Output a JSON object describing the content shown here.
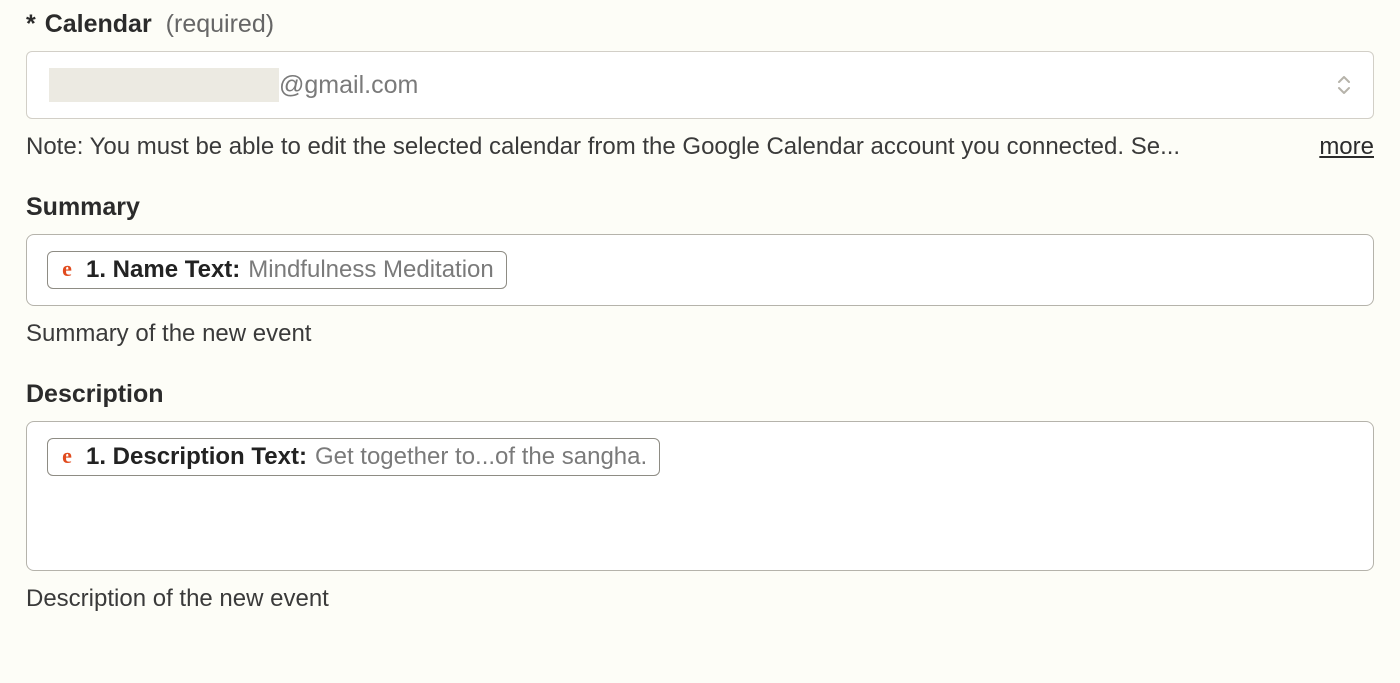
{
  "calendar": {
    "required_star": "*",
    "label": "Calendar",
    "required_text": "(required)",
    "value_suffix": "@gmail.com",
    "note": "Note: You must be able to edit the selected calendar from the Google Calendar account you connected. Se...",
    "more": "more"
  },
  "summary": {
    "label": "Summary",
    "pill_label": "1. Name Text:",
    "pill_value": "Mindfulness Meditation",
    "helper": "Summary of the new event"
  },
  "description": {
    "label": "Description",
    "pill_label": "1. Description Text:",
    "pill_value": "Get together to...of the sangha.",
    "helper": "Description of the new event"
  }
}
